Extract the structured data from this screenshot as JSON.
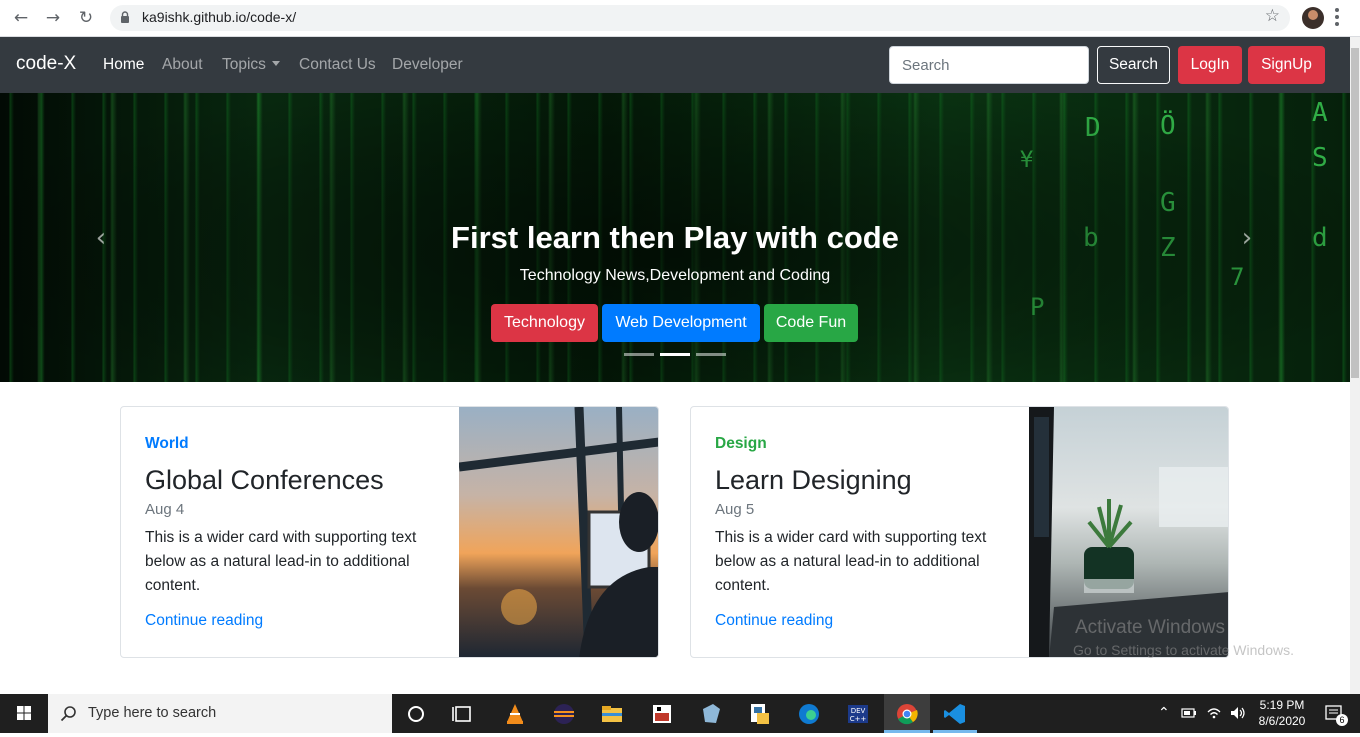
{
  "browser": {
    "url": "ka9ishk.github.io/code-x/",
    "back_icon": "arrow-left-icon",
    "forward_icon": "arrow-right-icon",
    "reload_icon": "reload-icon",
    "bookmark_icon": "star-icon"
  },
  "navbar": {
    "brand": "code-X",
    "links": [
      "Home",
      "About",
      "Topics",
      "Contact Us",
      "Developer"
    ],
    "search_placeholder": "Search",
    "search_button": "Search",
    "login_button": "LogIn",
    "signup_button": "SignUp",
    "colors": {
      "bg": "#343a40",
      "danger": "#dc3545"
    }
  },
  "carousel": {
    "title": "First learn then Play with code",
    "subtitle": "Technology News,Development and Coding",
    "buttons": [
      {
        "label": "Technology",
        "color": "#dc3545"
      },
      {
        "label": "Web Development",
        "color": "#007bff"
      },
      {
        "label": "Code Fun",
        "color": "#28a745"
      }
    ],
    "active_indicator": 2,
    "indicator_count": 3
  },
  "cards": [
    {
      "category": "World",
      "category_color": "#007bff",
      "title": "Global Conferences",
      "date": "Aug 4",
      "text": "This is a wider card with supporting text below as a natural lead-in to additional content.",
      "link": "Continue reading"
    },
    {
      "category": "Design",
      "category_color": "#28a745",
      "title": "Learn Designing",
      "date": "Aug 5",
      "text": "This is a wider card with supporting text below as a natural lead-in to additional content.",
      "link": "Continue reading"
    }
  ],
  "watermark": {
    "line1": "Activate Windows",
    "line2": "Go to Settings to activate Windows."
  },
  "taskbar": {
    "search_text": "Type here to search",
    "time": "5:19 PM",
    "date": "8/6/2020",
    "notification_count": "6"
  }
}
